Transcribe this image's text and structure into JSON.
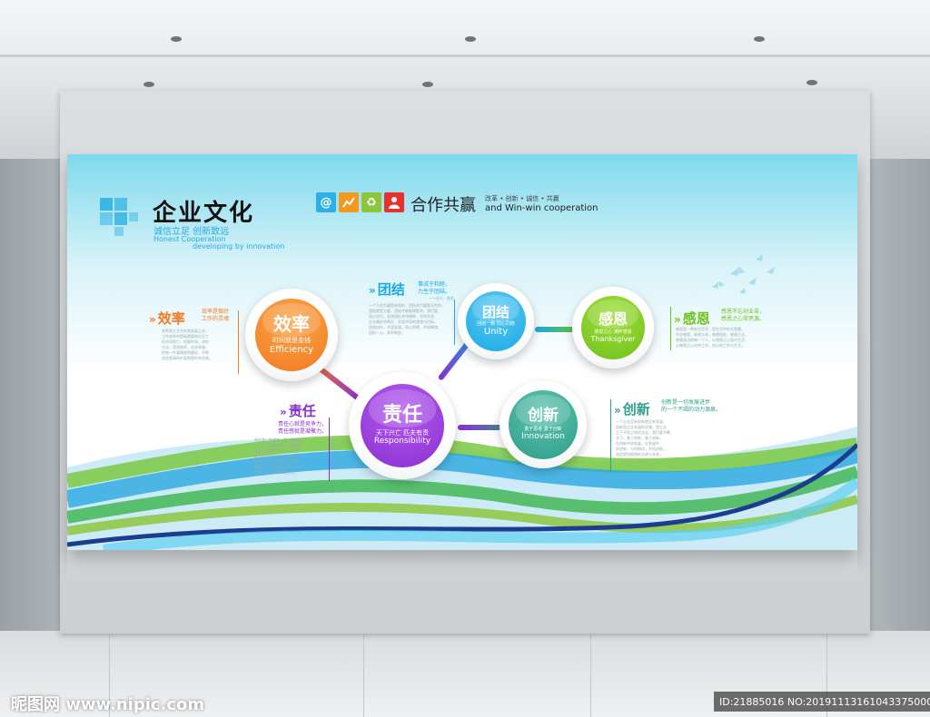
{
  "header": {
    "title": "企业文化",
    "slogan_cn": "诚信立足  创新致远",
    "slogan_en_1": "Honest Cooperation",
    "slogan_en_2": "developing by innovation",
    "icons": [
      {
        "icon": "at-icon",
        "glyph": "@",
        "color": "#2ab0e4"
      },
      {
        "icon": "chart-icon",
        "glyph": "📈",
        "color": "#f39a1e"
      },
      {
        "icon": "recycle-icon",
        "glyph": "♻",
        "color": "#8cc63f"
      },
      {
        "icon": "person-icon",
        "glyph": "👤",
        "color": "#e8312f"
      }
    ],
    "coop_cn": "合作共赢",
    "coop_small": "改革 • 创新 • 诚信 • 共赢",
    "coop_en": "and Win-win  cooperation"
  },
  "values": [
    {
      "key": "efficiency",
      "cn": "效率",
      "sub": "时间就是金钱",
      "en": "Efficiency",
      "color": "#f37a1f",
      "color2": "#f9a54a"
    },
    {
      "key": "unity",
      "cn": "团结",
      "sub": "团结一致  同心同德",
      "en": "Unity",
      "color": "#1aa9e6",
      "color2": "#5cc9f2"
    },
    {
      "key": "gratitude",
      "cn": "感恩",
      "sub": "感恩之心  满怀感恩",
      "en": "Thanksgiver",
      "color": "#6fc21c",
      "color2": "#a1dd3a"
    },
    {
      "key": "responsibility",
      "cn": "责任",
      "sub": "天下兴亡  匹夫有责",
      "en": "Responsibility",
      "color": "#8a2fcf",
      "color2": "#b45bef"
    },
    {
      "key": "innovation",
      "cn": "创新",
      "sub": "勇于思考  勇于创新",
      "en": "Innovation",
      "color": "#2f9d8a",
      "color2": "#5ec4ad"
    }
  ],
  "sections": {
    "efficiency": {
      "title": "效率",
      "tag": [
        "效率是做好",
        "工作的灵魂"
      ],
      "body": [
        "效率是企业生存和发展之本，",
        "工作效率的提高需要每位员工",
        "的共同努力，把握时间，讲究",
        "方法，提高效率，追求卓越，",
        "把每一件事情做到最好，不断",
        "创造更高的价值和更好的业绩。"
      ],
      "color": "#f37a1f"
    },
    "unity": {
      "title": "团结",
      "tag": [
        "事成于和睦，",
        "力生于团结。"
      ],
      "credit": "——古人 · 佚名",
      "body": [
        "一个人的力量是有限的，团队的力量是无穷的，",
        "团结就是力量，团结才能取得胜利，我们要",
        "同心协力，发扬团队合作精神，共同开创",
        "企业美好的明天，实现共同的理想与目标，",
        "团结协作，共谋发展，同心同德，共创辉煌。",
        "团结一心，其利断金。"
      ],
      "color": "#1aa9e6"
    },
    "gratitude": {
      "title": "感恩",
      "tag": [
        "感恩不忘创业苦，",
        "感恩之心常思源。"
      ],
      "body": [
        "感恩是一种处世哲学，是生活中的大智慧，",
        "学会感恩，感谢父母，感谢朋友，感谢企业，",
        "感谢身边的每一个人，以感恩之心面对生活，",
        "以感恩之心对待工作，快乐地工作与生活。"
      ],
      "color": "#6fc21c"
    },
    "responsibility": {
      "title": "责任",
      "tag": [
        "责任心就是竞争力，",
        "责任感就是凝聚力。"
      ],
      "body": [
        "责任是一种使命，是一种担当，",
        "一个人若没有责任心，就很难",
        "做好一件事情，每一个人都",
        "要有强烈的责任心，对自己",
        "负责，对企业负责，对客户",
        "负责，对社会负责，勇于担当，",
        "尽职尽责，做好本职工作。"
      ],
      "color": "#8a2fcf"
    },
    "innovation": {
      "title": "创新",
      "tag": [
        "创新是一切发展进步",
        "的一个不竭的动力源泉。"
      ],
      "body": [
        "一个企业没有创新就没有发展，",
        "创新是企业发展的灵魂，是企业",
        "立于不败之地的法宝，我们要不断",
        "学习，勇于创新，敢于创新，",
        "在创新中求发展，在发展中",
        "求创新，与时俱进，开拓进取，",
        "创造更加辉煌的业绩与未来。"
      ],
      "color": "#2f9d8a"
    }
  },
  "watermark": {
    "left": "昵图网 www.nipic.com",
    "right": "ID:21885016 NO:20191113161043375000"
  }
}
